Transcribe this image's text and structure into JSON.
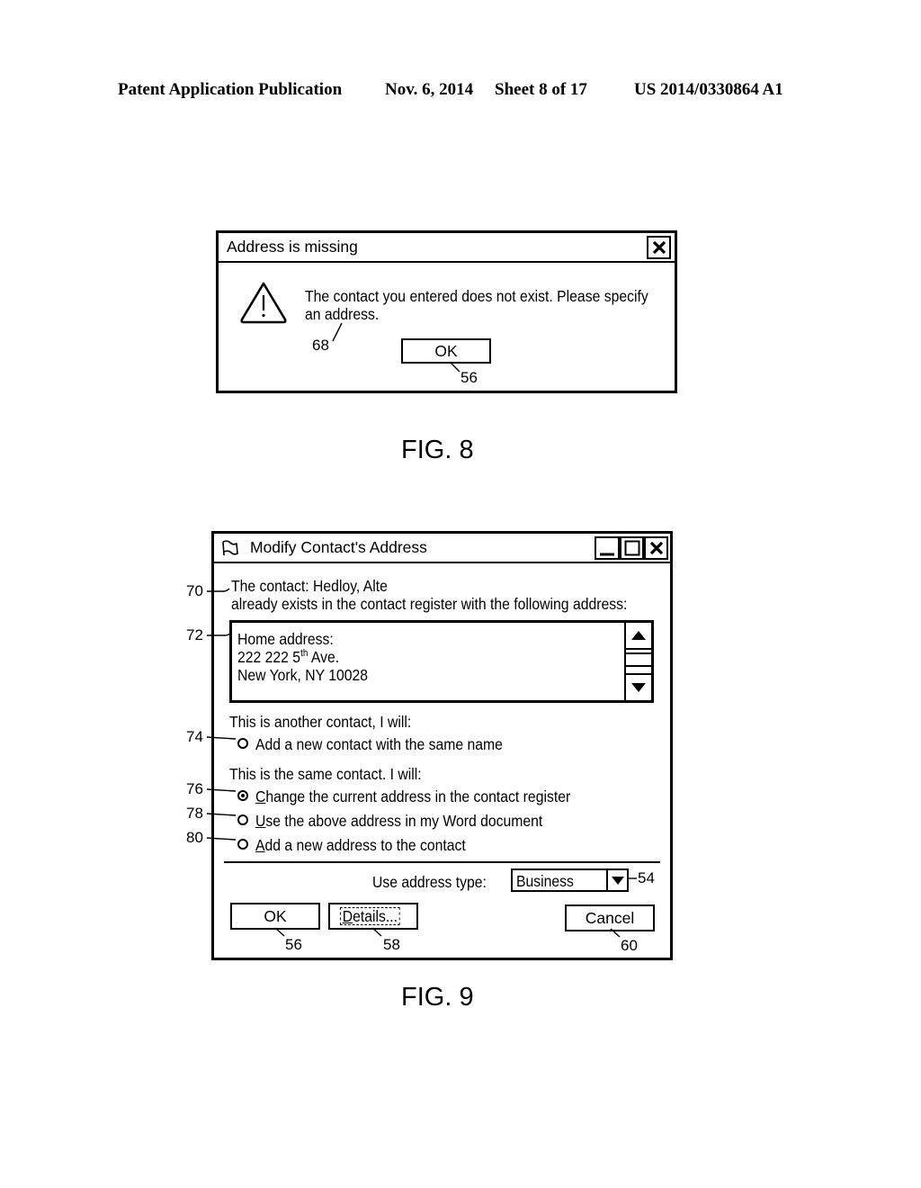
{
  "header": {
    "publication": "Patent Application Publication",
    "date": "Nov. 6, 2014",
    "sheet": "Sheet 8 of 17",
    "number": "US 2014/0330864 A1"
  },
  "fig8": {
    "caption": "FIG. 8",
    "dialog": {
      "title": "Address is missing",
      "close_icon": "close-icon",
      "warning_icon": "warning-triangle-icon",
      "message_line1": "The contact you entered does not exist. Please specify",
      "message_line2": "an address.",
      "ok_label": "OK"
    },
    "refs": {
      "message": "68",
      "ok": "56"
    }
  },
  "fig9": {
    "caption": "FIG. 9",
    "dialog": {
      "title": "Modify Contact's Address",
      "app_icon": "flag-icon",
      "minimize_icon": "minimize-icon",
      "maximize_icon": "maximize-icon",
      "close_icon": "close-icon",
      "contact_line1": "The contact: Hedloy, Alte",
      "contact_line2": "already exists in the contact register with the following address:",
      "address": {
        "line1": "Home address:",
        "line2_prefix": "222 222 5",
        "line2_sup": "th",
        "line2_suffix": " Ave.",
        "line3": "New York, NY 10028"
      },
      "section1_label": "This is another contact, I will:",
      "section2_label": "This is the same contact. I will:",
      "options": [
        {
          "label": "Add a new contact with the same name",
          "accel": "",
          "rest": "Add a new contact with the same name",
          "selected": false
        },
        {
          "label": "Change the current address in the contact register",
          "accel": "C",
          "rest": "hange the current address in the contact register",
          "selected": true
        },
        {
          "label": "Use the above address in my Word document",
          "accel": "U",
          "rest": "se the above address in my Word document",
          "selected": false
        },
        {
          "label": "Add a new address to the contact",
          "accel": "A",
          "rest": "dd a new address to the contact",
          "selected": false
        }
      ],
      "address_type_label": "Use address type:",
      "address_type_value": "Business",
      "ok_label": "OK",
      "details_accel": "D",
      "details_rest": "etails...",
      "cancel_label": "Cancel"
    },
    "refs": {
      "contact_text": "70",
      "address_box": "72",
      "opt_new_contact": "74",
      "opt_change": "76",
      "opt_use_above": "78",
      "opt_add_address": "80",
      "address_type": "54",
      "ok": "56",
      "details": "58",
      "cancel": "60"
    }
  }
}
